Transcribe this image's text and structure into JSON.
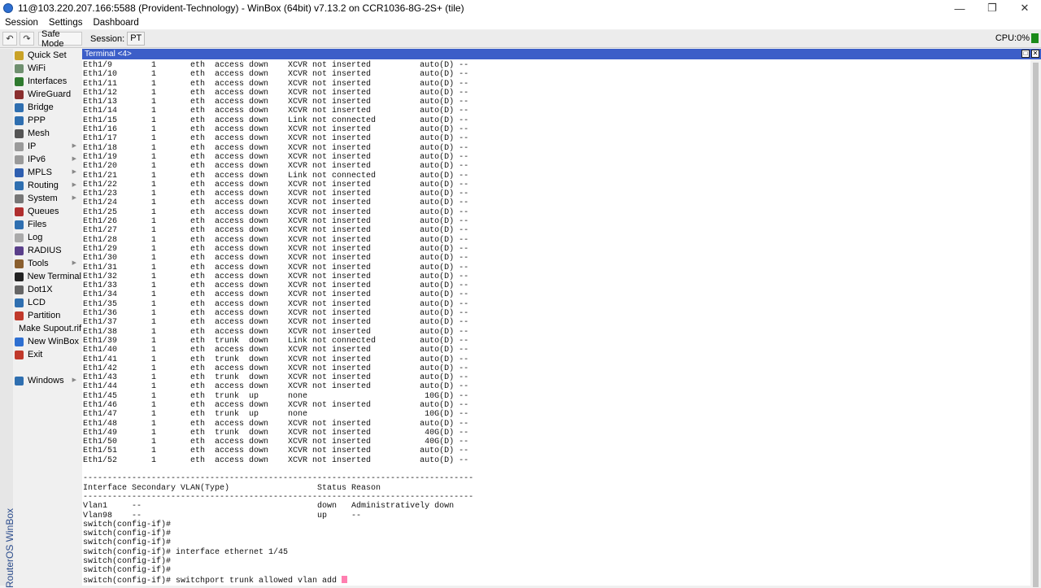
{
  "window": {
    "title": "11@103.220.207.166:5588 (Provident-Technology) - WinBox (64bit) v7.13.2 on CCR1036-8G-2S+ (tile)",
    "controls": [
      "—",
      "❐",
      "✕"
    ]
  },
  "menu": [
    "Session",
    "Settings",
    "Dashboard"
  ],
  "toolbar": {
    "undo": "↶",
    "redo": "↷",
    "safe_mode": "Safe Mode",
    "session_label": "Session:",
    "session_value": "PT",
    "cpu": "CPU:0%"
  },
  "brand": "RouterOS WinBox",
  "sidebar": [
    {
      "label": "Quick Set",
      "icon": "wand-icon",
      "color": "#c9a227",
      "arrow": false
    },
    {
      "label": "WiFi",
      "icon": "wifi-icon",
      "color": "#6f8f6f",
      "arrow": false
    },
    {
      "label": "Interfaces",
      "icon": "interfaces-icon",
      "color": "#2f7a2f",
      "arrow": false
    },
    {
      "label": "WireGuard",
      "icon": "wireguard-icon",
      "color": "#8a2f2f",
      "arrow": false
    },
    {
      "label": "Bridge",
      "icon": "bridge-icon",
      "color": "#2f6fb0",
      "arrow": false
    },
    {
      "label": "PPP",
      "icon": "ppp-icon",
      "color": "#2f6fb0",
      "arrow": false
    },
    {
      "label": "Mesh",
      "icon": "mesh-icon",
      "color": "#555555",
      "arrow": false
    },
    {
      "label": "IP",
      "icon": "ip-icon",
      "color": "#9a9a9a",
      "arrow": true
    },
    {
      "label": "IPv6",
      "icon": "ipv6-icon",
      "color": "#9a9a9a",
      "arrow": true
    },
    {
      "label": "MPLS",
      "icon": "mpls-icon",
      "color": "#2f5fb0",
      "arrow": true
    },
    {
      "label": "Routing",
      "icon": "routing-icon",
      "color": "#2f6fb0",
      "arrow": true
    },
    {
      "label": "System",
      "icon": "system-icon",
      "color": "#777777",
      "arrow": true
    },
    {
      "label": "Queues",
      "icon": "queues-icon",
      "color": "#b02f2f",
      "arrow": false
    },
    {
      "label": "Files",
      "icon": "files-icon",
      "color": "#2f6fb0",
      "arrow": false
    },
    {
      "label": "Log",
      "icon": "log-icon",
      "color": "#aaaaaa",
      "arrow": false
    },
    {
      "label": "RADIUS",
      "icon": "radius-icon",
      "color": "#5a3f8a",
      "arrow": false
    },
    {
      "label": "Tools",
      "icon": "tools-icon",
      "color": "#8a5f2f",
      "arrow": true
    },
    {
      "label": "New Terminal",
      "icon": "terminal-icon",
      "color": "#222222",
      "arrow": false
    },
    {
      "label": "Dot1X",
      "icon": "dot1x-icon",
      "color": "#666666",
      "arrow": false
    },
    {
      "label": "LCD",
      "icon": "lcd-icon",
      "color": "#2f6fb0",
      "arrow": false
    },
    {
      "label": "Partition",
      "icon": "partition-icon",
      "color": "#c0392b",
      "arrow": false
    },
    {
      "label": "Make Supout.rif",
      "icon": "supout-icon",
      "color": "#777777",
      "arrow": false
    },
    {
      "label": "New WinBox",
      "icon": "winbox-icon",
      "color": "#2e6fd1",
      "arrow": false
    },
    {
      "label": "Exit",
      "icon": "exit-icon",
      "color": "#c0392b",
      "arrow": false
    },
    {
      "label": "",
      "icon": "",
      "color": "",
      "arrow": false
    },
    {
      "label": "Windows",
      "icon": "windows-icon",
      "color": "#2f6fb0",
      "arrow": true
    }
  ],
  "terminal": {
    "title": "Terminal <4>",
    "lines": [
      "Eth1/9        1       eth  access down    XCVR not inserted          auto(D) --",
      "Eth1/10       1       eth  access down    XCVR not inserted          auto(D) --",
      "Eth1/11       1       eth  access down    XCVR not inserted          auto(D) --",
      "Eth1/12       1       eth  access down    XCVR not inserted          auto(D) --",
      "Eth1/13       1       eth  access down    XCVR not inserted          auto(D) --",
      "Eth1/14       1       eth  access down    XCVR not inserted          auto(D) --",
      "Eth1/15       1       eth  access down    Link not connected         auto(D) --",
      "Eth1/16       1       eth  access down    XCVR not inserted          auto(D) --",
      "Eth1/17       1       eth  access down    XCVR not inserted          auto(D) --",
      "Eth1/18       1       eth  access down    XCVR not inserted          auto(D) --",
      "Eth1/19       1       eth  access down    XCVR not inserted          auto(D) --",
      "Eth1/20       1       eth  access down    XCVR not inserted          auto(D) --",
      "Eth1/21       1       eth  access down    Link not connected         auto(D) --",
      "Eth1/22       1       eth  access down    XCVR not inserted          auto(D) --",
      "Eth1/23       1       eth  access down    XCVR not inserted          auto(D) --",
      "Eth1/24       1       eth  access down    XCVR not inserted          auto(D) --",
      "Eth1/25       1       eth  access down    XCVR not inserted          auto(D) --",
      "Eth1/26       1       eth  access down    XCVR not inserted          auto(D) --",
      "Eth1/27       1       eth  access down    XCVR not inserted          auto(D) --",
      "Eth1/28       1       eth  access down    XCVR not inserted          auto(D) --",
      "Eth1/29       1       eth  access down    XCVR not inserted          auto(D) --",
      "Eth1/30       1       eth  access down    XCVR not inserted          auto(D) --",
      "Eth1/31       1       eth  access down    XCVR not inserted          auto(D) --",
      "Eth1/32       1       eth  access down    XCVR not inserted          auto(D) --",
      "Eth1/33       1       eth  access down    XCVR not inserted          auto(D) --",
      "Eth1/34       1       eth  access down    XCVR not inserted          auto(D) --",
      "Eth1/35       1       eth  access down    XCVR not inserted          auto(D) --",
      "Eth1/36       1       eth  access down    XCVR not inserted          auto(D) --",
      "Eth1/37       1       eth  access down    XCVR not inserted          auto(D) --",
      "Eth1/38       1       eth  access down    XCVR not inserted          auto(D) --",
      "Eth1/39       1       eth  trunk  down    Link not connected         auto(D) --",
      "Eth1/40       1       eth  access down    XCVR not inserted          auto(D) --",
      "Eth1/41       1       eth  trunk  down    XCVR not inserted          auto(D) --",
      "Eth1/42       1       eth  access down    XCVR not inserted          auto(D) --",
      "Eth1/43       1       eth  trunk  down    XCVR not inserted          auto(D) --",
      "Eth1/44       1       eth  access down    XCVR not inserted          auto(D) --",
      "Eth1/45       1       eth  trunk  up      none                        10G(D) --",
      "Eth1/46       1       eth  access down    XCVR not inserted          auto(D) --",
      "Eth1/47       1       eth  trunk  up      none                        10G(D) --",
      "Eth1/48       1       eth  access down    XCVR not inserted          auto(D) --",
      "Eth1/49       1       eth  trunk  down    XCVR not inserted           40G(D) --",
      "Eth1/50       1       eth  access down    XCVR not inserted           40G(D) --",
      "Eth1/51       1       eth  access down    XCVR not inserted          auto(D) --",
      "Eth1/52       1       eth  access down    XCVR not inserted          auto(D) --",
      "",
      "--------------------------------------------------------------------------------",
      "Interface Secondary VLAN(Type)                  Status Reason",
      "--------------------------------------------------------------------------------",
      "Vlan1     --                                    down   Administratively down",
      "Vlan98    --                                    up     --",
      "switch(config-if)#",
      "switch(config-if)#",
      "switch(config-if)#",
      "switch(config-if)# interface ethernet 1/45",
      "switch(config-if)#",
      "switch(config-if)#"
    ],
    "prompt_line": "switch(config-if)# switchport trunk allowed vlan add "
  }
}
